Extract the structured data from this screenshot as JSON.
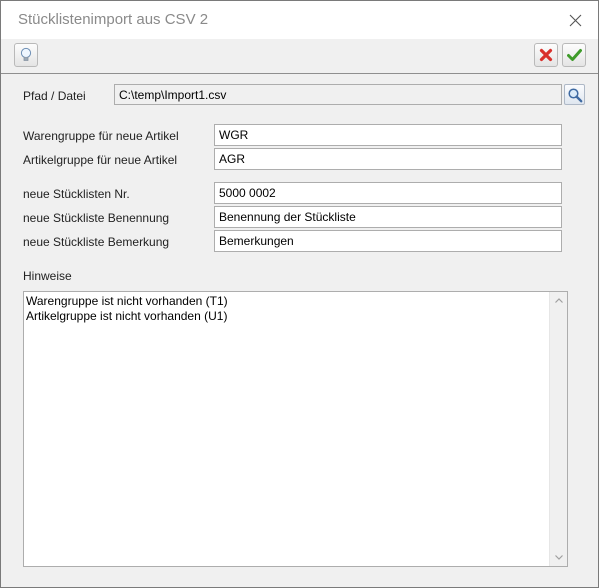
{
  "window": {
    "title": "Stücklistenimport aus CSV 2"
  },
  "toolbar": {
    "info_icon": "lightbulb-icon",
    "cancel_icon": "red-x-icon",
    "ok_icon": "green-check-icon",
    "cancel_color": "#d9302c",
    "ok_color": "#3e9b2a"
  },
  "form": {
    "path_label": "Pfad / Datei",
    "path_value": "C:\\temp\\Import1.csv",
    "browse_icon": "magnifier-icon",
    "product_group_label": "Warengruppe für neue Artikel",
    "product_group_value": "WGR",
    "article_group_label": "Artikelgruppe für neue Artikel",
    "article_group_value": "AGR",
    "bom_number_label": "neue Stücklisten Nr.",
    "bom_number_value": "5000 0002",
    "bom_name_label": "neue Stückliste Benennung",
    "bom_name_value": "Benennung der Stückliste",
    "bom_remark_label": "neue Stückliste Bemerkung",
    "bom_remark_value": "Bemerkungen"
  },
  "notes": {
    "label": "Hinweise",
    "text": "Warengruppe ist nicht vorhanden (T1)\nArtikelgruppe ist nicht vorhanden (U1)"
  }
}
